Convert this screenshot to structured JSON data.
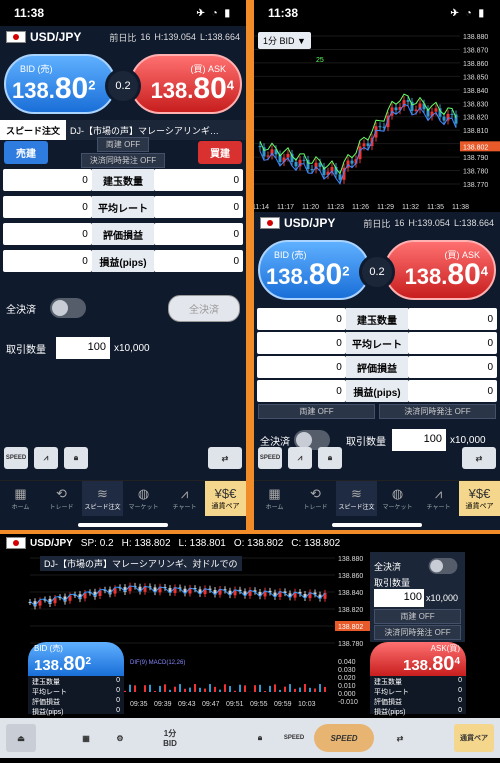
{
  "status": {
    "time": "11:38"
  },
  "symbol": "USD/JPY",
  "header": {
    "prev_label": "前日比",
    "prev_value": "16",
    "high_label": "H:",
    "high": "139.054",
    "low_label": "L:",
    "low": "138.664",
    "high2": "139.054",
    "low2": "138.664"
  },
  "bid": {
    "label": "BID (売)",
    "main": "138.",
    "big": "80",
    "small": "2"
  },
  "ask": {
    "label": "(買) ASK",
    "main": "138.",
    "big": "80",
    "small": "4"
  },
  "spread": "0.2",
  "tabs": {
    "speed": "スピード注文",
    "news": "DJ-【市場の声】マレーシアリンギ…"
  },
  "order": {
    "sell": "売建",
    "buy": "買建",
    "both": "両建 OFF",
    "simul": "決済同時発注 OFF"
  },
  "positions": [
    {
      "label": "建玉数量",
      "left": "0",
      "right": "0"
    },
    {
      "label": "平均レート",
      "left": "0",
      "right": "0"
    },
    {
      "label": "評価損益",
      "left": "0",
      "right": "0"
    },
    {
      "label": "損益(pips)",
      "left": "0",
      "right": "0"
    }
  ],
  "all_close": "全決済",
  "all_close_btn": "全決済",
  "qty": {
    "label": "取引数量",
    "value": "100",
    "unit": "x10,000"
  },
  "nav": [
    "ホーム",
    "トレード",
    "スピード注文",
    "マーケット",
    "チャート",
    "通貨ペア"
  ],
  "tools": {
    "speed": "SPEED"
  },
  "p2": {
    "timeframe": "1分 BID",
    "y_ticks": [
      "138.880",
      "138.870",
      "138.860",
      "138.850",
      "138.840",
      "138.830",
      "138.820",
      "138.810",
      "138.800",
      "138.790",
      "138.780",
      "138.770"
    ],
    "current": "138.802",
    "x_ticks": [
      "11:14",
      "11:17",
      "11:20",
      "11:23",
      "11:26",
      "11:29",
      "11:32",
      "11:35",
      "11:38"
    ],
    "ma_label": "25"
  },
  "p3": {
    "sp": "SP: 0.2",
    "h": "H: 138.802",
    "l": "L: 138.801",
    "o": "O: 138.802",
    "c": "C: 138.802",
    "news": "DJ-【市場の声】マレーシアリンギ、対ドルでの",
    "y_ticks": [
      "138.880",
      "138.860",
      "138.840",
      "138.820",
      "138.802",
      "138.780"
    ],
    "osc_ticks": [
      "0.040",
      "0.030",
      "0.020",
      "0.010",
      "0.000",
      "-0.010"
    ],
    "x_ticks": [
      "09:35",
      "09:39",
      "09:43",
      "09:47",
      "09:51",
      "09:55",
      "09:59",
      "10:03"
    ],
    "bid_label": "BID (売)",
    "ask_label": "ASK(買)",
    "pos_labels": [
      "建玉数量",
      "平均レート",
      "評価損益",
      "損益(pips)"
    ],
    "pos_values": [
      "0",
      "0",
      "0",
      "0"
    ],
    "tf": "1分",
    "tf2": "BID",
    "speed": "SPEED",
    "pair": "通貨ペア",
    "osc_legend": "DIF(9) MACD(12,26)"
  },
  "colors": {
    "accent": "#f28c28",
    "bid": "#1a6fd8",
    "ask": "#c81e1e"
  }
}
